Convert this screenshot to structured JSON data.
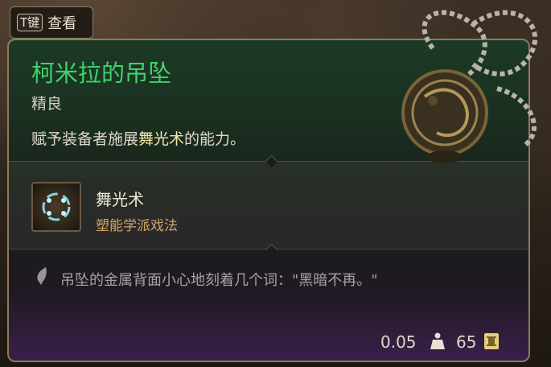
{
  "hint": {
    "key": "T键",
    "label": "查看"
  },
  "item": {
    "title": "柯米拉的吊坠",
    "rarity": "精良",
    "description": {
      "prefix": "赋予装备者施展",
      "highlight": "舞光术",
      "suffix": "的能力。"
    }
  },
  "spell": {
    "name": "舞光术",
    "school": "塑能学派戏法",
    "icon": "dancing-lights-icon"
  },
  "lore": {
    "icon": "quill-icon",
    "text": "吊坠的金属背面小心地刻着几个词：\"黑暗不再。\""
  },
  "stats": {
    "weight": "0.05",
    "weight_icon": "weight-icon",
    "price": "65",
    "price_icon": "gold-coin-icon"
  },
  "colors": {
    "title": "#3fd26b",
    "school": "#cfa56c",
    "highlight": "#f4e7a6",
    "border": "#8d7b59"
  }
}
